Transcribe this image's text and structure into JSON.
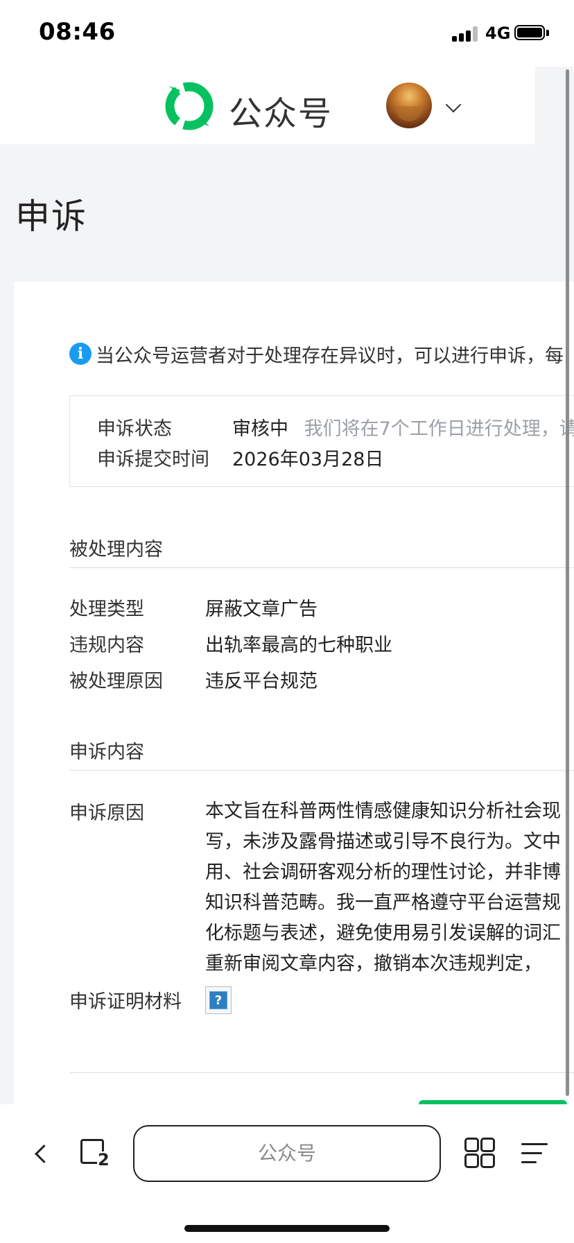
{
  "status_bar": {
    "time": "08:46",
    "network": "4G"
  },
  "header": {
    "logo_text": "公众号"
  },
  "page": {
    "title": "申诉"
  },
  "notice": {
    "text": "当公众号运营者对于处理存在异议时，可以进行申诉，每"
  },
  "appeal_status": {
    "status_label": "申诉状态",
    "status_value": "审核中",
    "status_note": "我们将在7个工作日进行处理，请",
    "time_label": "申诉提交时间",
    "time_value": "2026年03月28日"
  },
  "processed_section": {
    "title": "被处理内容",
    "rows": [
      {
        "label": "处理类型",
        "value": "屏蔽文章广告"
      },
      {
        "label": "违规内容",
        "value": "出轨率最高的七种职业"
      },
      {
        "label": "被处理原因",
        "value": "违反平台规范"
      }
    ]
  },
  "appeal_section": {
    "title": "申诉内容",
    "reason_label": "申诉原因",
    "reason_lines": [
      "本文旨在科普两性情感健康知识分析社会现",
      "写，未涉及露骨描述或引导不良行为。文中",
      "用、社会调研客观分析的理性讨论，并非博",
      "知识科普范畴。我一直严格遵守平台运营规",
      "化标题与表述，避免使用易引发误解的词汇",
      "重新审阅文章内容，撤销本次违规判定，"
    ],
    "proof_label": "申诉证明材料",
    "proof_placeholder": "?"
  },
  "bottom_bar": {
    "tab_count": "2",
    "address": "公众号"
  },
  "colors": {
    "accent_green": "#07c160",
    "link": "#576b95",
    "info_blue": "#1a9bf0"
  },
  "icons": [
    "signal-icon",
    "battery-icon",
    "wechat-official-logo-icon",
    "chevron-down-icon",
    "info-icon",
    "back-icon",
    "tabs-icon",
    "grid-icon",
    "menu-icon"
  ]
}
